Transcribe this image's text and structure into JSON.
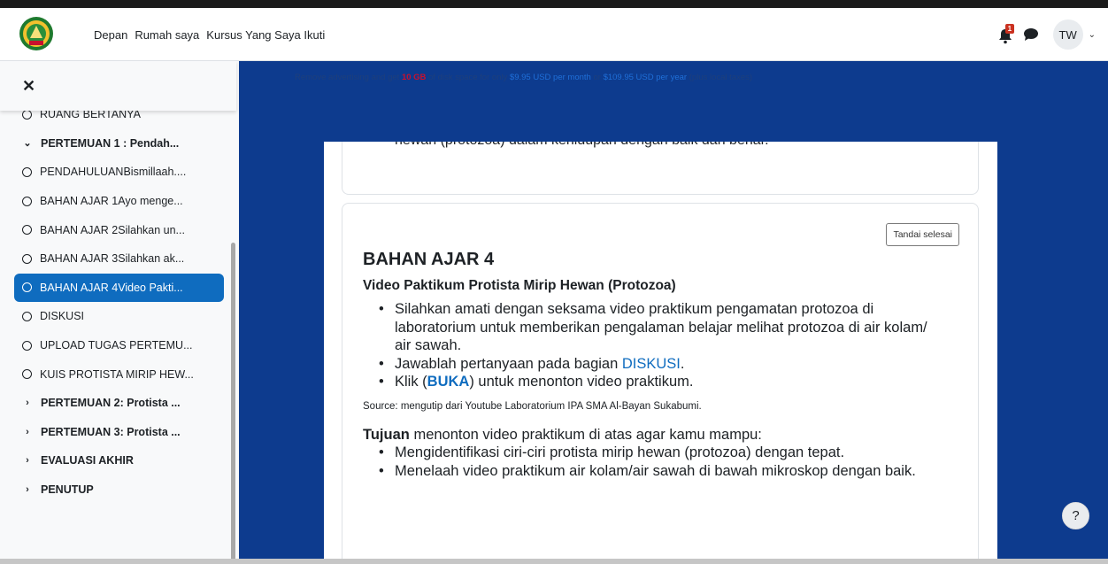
{
  "navbar": {
    "links": [
      "Depan",
      "Rumah saya",
      "Kursus Yang Saya Ikuti"
    ],
    "notification_count": "1",
    "avatar_initials": "TW"
  },
  "sidebar": {
    "items": [
      {
        "type": "activity",
        "label": "RUANG BERTANYA"
      },
      {
        "type": "section-open",
        "label": "PERTEMUAN 1 : Pendah..."
      },
      {
        "type": "activity",
        "label": "PENDAHULUANBismillaah...."
      },
      {
        "type": "activity",
        "label": "BAHAN AJAR 1Ayo menge..."
      },
      {
        "type": "activity",
        "label": "BAHAN AJAR 2Silahkan un..."
      },
      {
        "type": "activity",
        "label": "BAHAN AJAR 3Silahkan ak..."
      },
      {
        "type": "activity-active",
        "label": "BAHAN AJAR 4Video Pakti..."
      },
      {
        "type": "activity",
        "label": "DISKUSI"
      },
      {
        "type": "activity",
        "label": "UPLOAD TUGAS PERTEMU..."
      },
      {
        "type": "activity",
        "label": "KUIS PROTISTA MIRIP HEW..."
      },
      {
        "type": "section-closed",
        "label": "PERTEMUAN 2: Protista ..."
      },
      {
        "type": "section-closed",
        "label": "PERTEMUAN 3: Protista ..."
      },
      {
        "type": "section-closed",
        "label": "EVALUASI AKHIR"
      },
      {
        "type": "section-closed",
        "label": "PENUTUP"
      }
    ]
  },
  "ad": {
    "part1": "Remove advertising and get ",
    "highlight": "10 GB",
    "part2": " of disk space for only ",
    "price_month": "$9.95 USD per month",
    "part3": " or ",
    "price_year": "$109.95 USD per year",
    "part4": " (plus local taxes)"
  },
  "card1": {
    "text": "hewan (protozoa) dalam kehidupan dengan baik dan benar."
  },
  "card2": {
    "mark_button": "Tandai selesai",
    "title": "BAHAN AJAR 4",
    "subtitle": "Video Paktikum Protista Mirip Hewan (Protozoa)",
    "bullet1": "Silahkan amati dengan seksama video praktikum pengamatan protozoa di laboratorium untuk memberikan pengalaman belajar melihat protozoa di air kolam/ air sawah.",
    "bullet2_pre": "Jawablah pertanyaan pada bagian ",
    "bullet2_link": "DISKUSI",
    "bullet2_post": ".",
    "bullet3_pre": "Klik (",
    "bullet3_link": "BUKA",
    "bullet3_post": ") untuk menonton video praktikum.",
    "source": "Source: mengutip dari Youtube Laboratorium IPA SMA Al-Bayan Sukabumi.",
    "tujuan_bold": "Tujuan",
    "tujuan_rest": " menonton video praktikum di atas agar kamu mampu:",
    "goal1": "Mengidentifikasi ciri-ciri protista mirip hewan (protozoa) dengan tepat.",
    "goal2": "Menelaah video praktikum air kolam/air sawah di bawah mikroskop dengan baik."
  },
  "help_button": "?"
}
